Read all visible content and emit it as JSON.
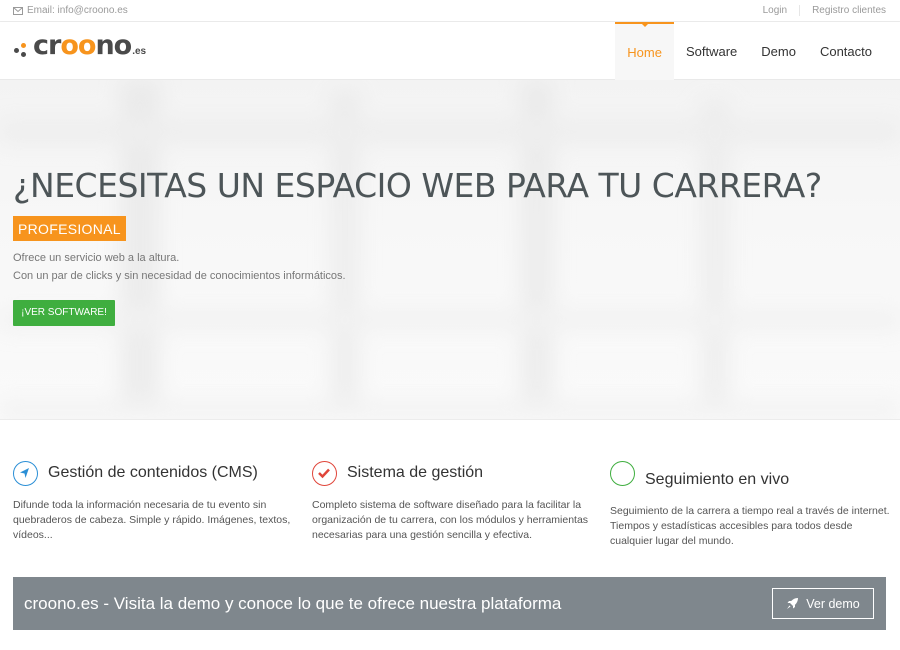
{
  "topbar": {
    "email": "Email: info@croono.es",
    "login": "Login",
    "registro": "Registro clientes"
  },
  "logo": {
    "text_a": "cr",
    "text_b": "oo",
    "text_c": "no",
    "tld": ".es"
  },
  "nav": [
    {
      "label": "Home",
      "active": true
    },
    {
      "label": "Software"
    },
    {
      "label": "Demo"
    },
    {
      "label": "Contacto"
    }
  ],
  "hero": {
    "title": "¿NECESITAS UN ESPACIO WEB PARA TU CARRERA?",
    "badge": "PROFESIONAL",
    "line1": "Ofrece un servicio web a la altura.",
    "line2": "Con un par de clicks y sin necesidad de conocimientos informáticos.",
    "button": "¡VER SOFTWARE!"
  },
  "features": [
    {
      "icon": "location-arrow-icon",
      "title": "Gestión de contenidos (CMS)",
      "text": "Difunde toda la información necesaria de tu evento sin quebraderos de cabeza. Simple y rápido. Imágenes, textos, vídeos..."
    },
    {
      "icon": "checkmark-icon",
      "title": "Sistema de gestión",
      "text": "Completo sistema de software diseñado para la facilitar la organización de tu carrera, con los módulos y herramientas necesarias para una gestión sencilla y efectiva."
    },
    {
      "icon": "circle-icon",
      "title": "Seguimiento en vivo",
      "text": "Seguimiento de la carrera a tiempo real a través de internet. Tiempos y estadísticas accesibles para todos desde cualquier lugar del mundo."
    }
  ],
  "cta": {
    "text": "croono.es - Visita la demo y conoce lo que te ofrece nuestra plataforma",
    "button": "Ver demo"
  },
  "colors": {
    "accent": "#f7941d",
    "green": "#3fae3f",
    "blue": "#2b8fd6",
    "red": "#e0453a",
    "cta_bg": "#7f878d"
  }
}
